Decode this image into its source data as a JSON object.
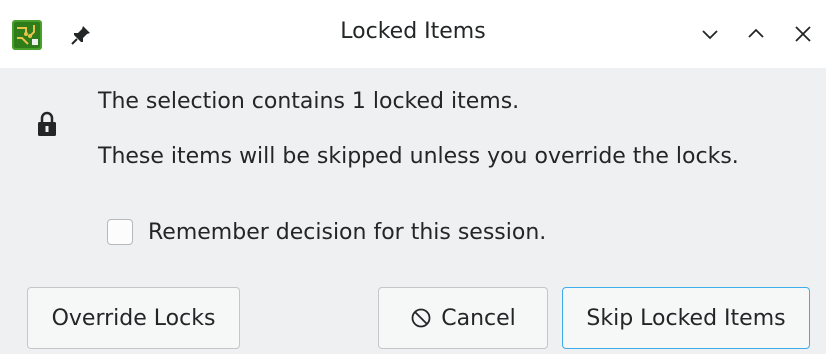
{
  "window": {
    "title": "Locked Items"
  },
  "message": {
    "line1": "The selection contains 1 locked items.",
    "line2": "These items will be skipped unless you override the locks."
  },
  "remember": {
    "label": "Remember decision for this session.",
    "checked": false
  },
  "buttons": {
    "override": "Override Locks",
    "cancel": "Cancel",
    "skip": "Skip Locked Items"
  },
  "colors": {
    "accent": "#3daee9",
    "app_icon_green": "#4a9e2a"
  },
  "icons": {
    "app": "pcb-app-icon",
    "pin": "pin-icon",
    "lock": "lock-icon",
    "cancel": "cancel-icon"
  }
}
